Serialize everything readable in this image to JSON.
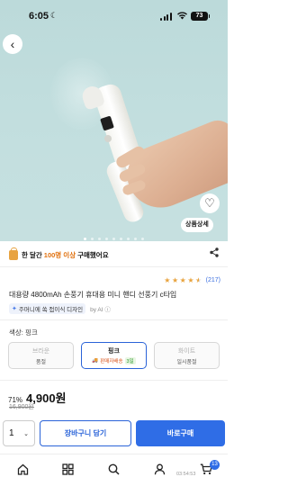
{
  "status_bar": {
    "time": "6:05",
    "battery": "73"
  },
  "hero": {
    "detail_button": "상품상세",
    "image_count": 9,
    "active_image": 0
  },
  "purchase_info": {
    "prefix": "한 달간",
    "highlight": "100명 이상",
    "suffix": "구매했어요"
  },
  "rating": {
    "stars": 4.5,
    "count": "(217)"
  },
  "product": {
    "title": "대용량 4800mAh 손풍기 휴대용 미니 핸디 선풍기 c타입",
    "ai_badge": "주머니에 쏙 접이식 디자인",
    "ai_by": "by AI ⓘ"
  },
  "color_option": {
    "label": "색상: 핑크",
    "options": [
      {
        "name": "브라운",
        "sub": "품절"
      },
      {
        "name": "핑크",
        "arrival": "판매자배송",
        "arrival_tag": "3일"
      },
      {
        "name": "화이트",
        "sub": "일시품절"
      }
    ]
  },
  "price": {
    "discount": "71%",
    "current": "4,900원",
    "original": "16,900원"
  },
  "actions": {
    "quantity": "1",
    "cart_label": "장바구니 담기",
    "buy_label": "바로구매"
  },
  "tabbar": {
    "cart_count": "13",
    "clock": "03:54:53"
  },
  "colors": {
    "accent": "#2f6de6",
    "star": "#e8a33d",
    "highlight": "#e0700d"
  }
}
